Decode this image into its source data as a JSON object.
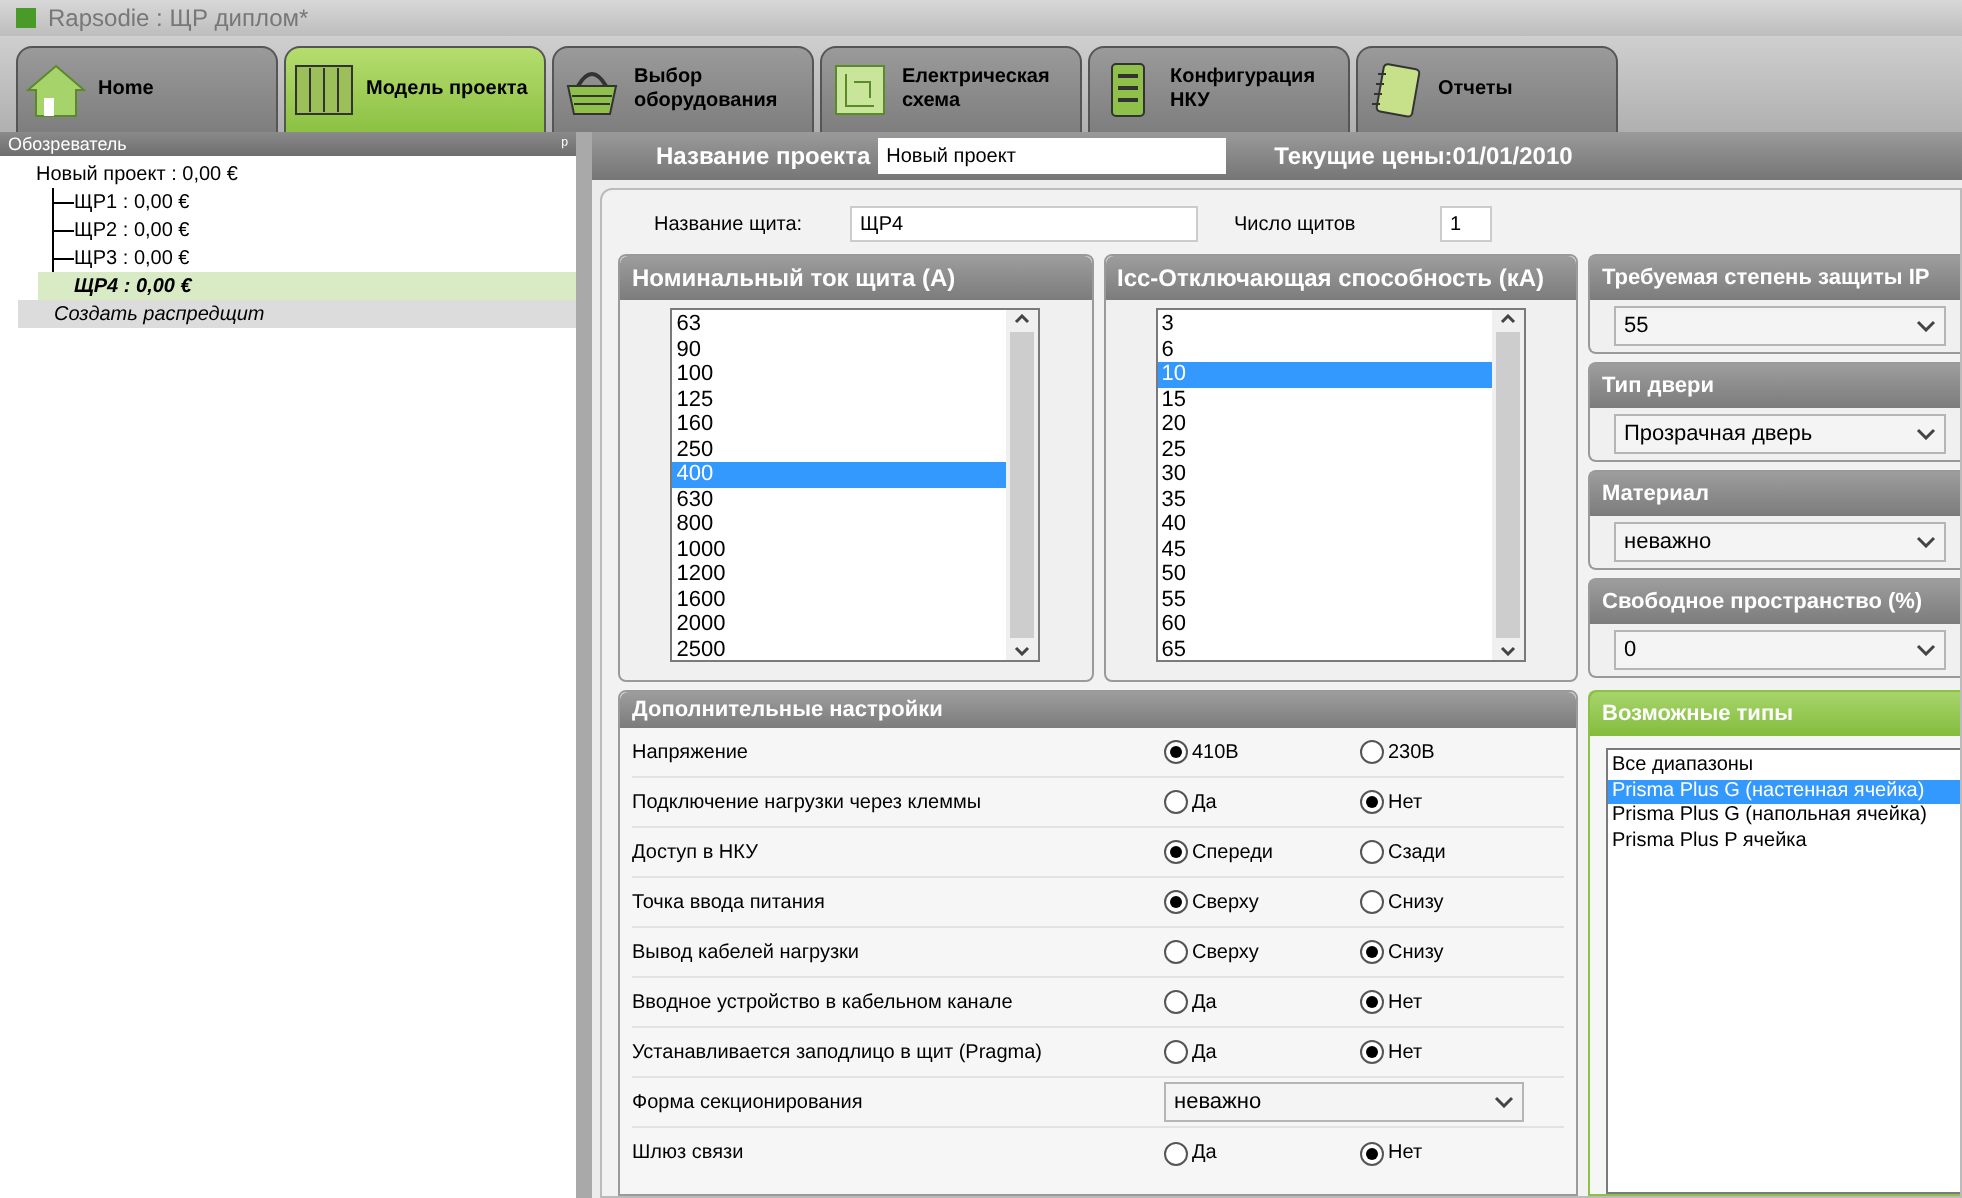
{
  "window": {
    "title": "Rapsodie : ЩР диплом*"
  },
  "tabs": [
    {
      "label": "Home",
      "kind": "house",
      "selected": false
    },
    {
      "label": "Модель проекта",
      "kind": "cabinet",
      "selected": true
    },
    {
      "label": "Выбор оборудования",
      "kind": "basket",
      "selected": false
    },
    {
      "label": "Електрическая схема",
      "kind": "diagram",
      "selected": false
    },
    {
      "label": "Конфигурация НКУ",
      "kind": "book",
      "selected": false
    },
    {
      "label": "Отчеты",
      "kind": "notebook",
      "selected": false
    }
  ],
  "explorer": {
    "title": "Обозреватель",
    "pin": "ᵖ",
    "tree": [
      {
        "label": "Новый проект : 0,00 €",
        "selected": false,
        "children": [
          {
            "label": "ЩР1 : 0,00 €",
            "selected": false
          },
          {
            "label": "ЩР2 : 0,00 €",
            "selected": false
          },
          {
            "label": "ЩР3 : 0,00 €",
            "selected": false
          },
          {
            "label": "ЩР4 : 0,00 €",
            "selected": true
          },
          {
            "label": "Создать распредщит",
            "selected": false,
            "kind": "action"
          }
        ]
      }
    ]
  },
  "project": {
    "name_label": "Название проекта",
    "name": "Новый проект",
    "prices": "Текущие цены:01/01/2010"
  },
  "board": {
    "name_label": "Название щита:",
    "name": "ЩР4",
    "count_label": "Число щитов",
    "count": "1"
  },
  "lists": [
    {
      "title": "Номинальный ток щита (А)",
      "items": [
        {
          "label": "63",
          "selected": false
        },
        {
          "label": "90",
          "selected": false
        },
        {
          "label": "100",
          "selected": false
        },
        {
          "label": "125",
          "selected": false
        },
        {
          "label": "160",
          "selected": false
        },
        {
          "label": "250",
          "selected": false
        },
        {
          "label": "400",
          "selected": true
        },
        {
          "label": "630",
          "selected": false
        },
        {
          "label": "800",
          "selected": false
        },
        {
          "label": "1000",
          "selected": false
        },
        {
          "label": "1200",
          "selected": false
        },
        {
          "label": "1600",
          "selected": false
        },
        {
          "label": "2000",
          "selected": false
        },
        {
          "label": "2500",
          "selected": false
        }
      ]
    },
    {
      "title": "Icc-Отключающая способность (кА)",
      "items": [
        {
          "label": "3",
          "selected": false
        },
        {
          "label": "6",
          "selected": false
        },
        {
          "label": "10",
          "selected": true
        },
        {
          "label": "15",
          "selected": false
        },
        {
          "label": "20",
          "selected": false
        },
        {
          "label": "25",
          "selected": false
        },
        {
          "label": "30",
          "selected": false
        },
        {
          "label": "35",
          "selected": false
        },
        {
          "label": "40",
          "selected": false
        },
        {
          "label": "45",
          "selected": false
        },
        {
          "label": "50",
          "selected": false
        },
        {
          "label": "55",
          "selected": false
        },
        {
          "label": "60",
          "selected": false
        },
        {
          "label": "65",
          "selected": false
        }
      ]
    }
  ],
  "options": [
    {
      "title": "Требуемая степень защиты IP",
      "value": "55"
    },
    {
      "title": "Тип двери",
      "value": "Прозрачная дверь"
    },
    {
      "title": "Материал",
      "value": "неважно"
    },
    {
      "title": "Свободное пространство (%)",
      "value": "0"
    }
  ],
  "extra": {
    "title": "Дополнительные настройки",
    "rows": [
      {
        "kind": "radio",
        "label": "Напряжение",
        "choices": [
          {
            "label": "410В",
            "selected": true
          },
          {
            "label": "230В",
            "selected": false
          }
        ]
      },
      {
        "kind": "radio",
        "label": "Подключение нагрузки через клеммы",
        "choices": [
          {
            "label": "Да",
            "selected": false
          },
          {
            "label": "Нет",
            "selected": true
          }
        ]
      },
      {
        "kind": "radio",
        "label": "Доступ в НКУ",
        "choices": [
          {
            "label": "Спереди",
            "selected": true
          },
          {
            "label": "Сзади",
            "selected": false
          }
        ]
      },
      {
        "kind": "radio",
        "label": "Точка ввода питания",
        "choices": [
          {
            "label": "Сверху",
            "selected": true
          },
          {
            "label": "Снизу",
            "selected": false
          }
        ]
      },
      {
        "kind": "radio",
        "label": "Вывод кабелей нагрузки",
        "choices": [
          {
            "label": "Сверху",
            "selected": false
          },
          {
            "label": "Снизу",
            "selected": true
          }
        ]
      },
      {
        "kind": "radio",
        "label": "Вводное устройство в кабельном канале",
        "choices": [
          {
            "label": "Да",
            "selected": false
          },
          {
            "label": "Нет",
            "selected": true
          }
        ]
      },
      {
        "kind": "radio",
        "label": "Устанавливается заподлицо в щит (Pragma)",
        "choices": [
          {
            "label": "Да",
            "selected": false
          },
          {
            "label": "Нет",
            "selected": true
          }
        ]
      },
      {
        "kind": "select",
        "label": "Форма секционирования",
        "value": "неважно"
      },
      {
        "kind": "radio",
        "label": "Шлюз связи",
        "choices": [
          {
            "label": "Да",
            "selected": false
          },
          {
            "label": "Нет",
            "selected": true
          }
        ]
      }
    ]
  },
  "types": {
    "title": "Возможные типы",
    "items": [
      {
        "label": "Все диапазоны",
        "selected": false
      },
      {
        "label": "Prisma Plus G (настенная ячейка)",
        "selected": true
      },
      {
        "label": "Prisma Plus G (напольная ячейка)",
        "selected": false
      },
      {
        "label": "Prisma Plus P ячейка",
        "selected": false
      }
    ]
  }
}
